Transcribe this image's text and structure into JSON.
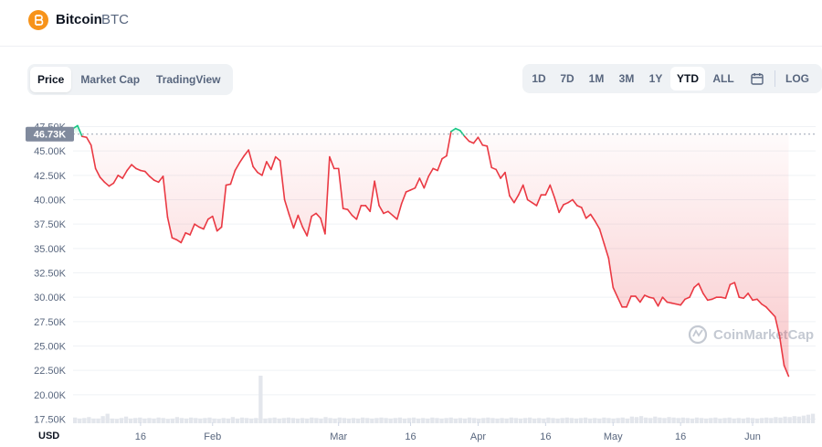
{
  "header": {
    "coin_name": "Bitcoin",
    "coin_symbol": "BTC",
    "logo_color": "#f7931a"
  },
  "tabs": [
    {
      "label": "Price",
      "active": true
    },
    {
      "label": "Market Cap",
      "active": false
    },
    {
      "label": "TradingView",
      "active": false
    }
  ],
  "ranges": [
    {
      "label": "1D",
      "active": false
    },
    {
      "label": "7D",
      "active": false
    },
    {
      "label": "1M",
      "active": false
    },
    {
      "label": "3M",
      "active": false
    },
    {
      "label": "1Y",
      "active": false
    },
    {
      "label": "YTD",
      "active": true
    },
    {
      "label": "ALL",
      "active": false
    }
  ],
  "calendar_icon": "calendar-icon",
  "log_label": "LOG",
  "watermark": "CoinMarketCap",
  "chart_data": {
    "type": "line",
    "currency_label": "USD",
    "reference_value": 46.73,
    "reference_label": "46.73K",
    "ylim": [
      17.5,
      48.25
    ],
    "y_unit": "K",
    "y_ticks": [
      {
        "v": 17.5,
        "label": "17.50K"
      },
      {
        "v": 20.0,
        "label": "20.00K"
      },
      {
        "v": 22.5,
        "label": "22.50K"
      },
      {
        "v": 25.0,
        "label": "25.00K"
      },
      {
        "v": 27.5,
        "label": "27.50K"
      },
      {
        "v": 30.0,
        "label": "30.00K"
      },
      {
        "v": 32.5,
        "label": "32.50K"
      },
      {
        "v": 35.0,
        "label": "35.00K"
      },
      {
        "v": 37.5,
        "label": "37.50K"
      },
      {
        "v": 40.0,
        "label": "40.00K"
      },
      {
        "v": 42.5,
        "label": "42.50K"
      },
      {
        "v": 45.0,
        "label": "45.00K"
      },
      {
        "v": 47.5,
        "label": "47.50K"
      }
    ],
    "x_ticks": [
      {
        "day": 15,
        "label": "16"
      },
      {
        "day": 31,
        "label": "Feb"
      },
      {
        "day": 59,
        "label": "Mar"
      },
      {
        "day": 75,
        "label": "16"
      },
      {
        "day": 90,
        "label": "Apr"
      },
      {
        "day": 105,
        "label": "16"
      },
      {
        "day": 120,
        "label": "May"
      },
      {
        "day": 135,
        "label": "16"
      },
      {
        "day": 151,
        "label": "Jun"
      }
    ],
    "xlim": [
      0,
      165
    ],
    "up_color": "#16c784",
    "down_color": "#ea3943",
    "series": [
      {
        "points": [
          [
            0,
            47.3
          ],
          [
            1,
            47.6
          ],
          [
            2,
            46.5
          ],
          [
            3,
            46.4
          ],
          [
            4,
            45.6
          ],
          [
            5,
            43.2
          ],
          [
            6,
            42.3
          ],
          [
            7,
            41.8
          ],
          [
            8,
            41.4
          ],
          [
            9,
            41.7
          ],
          [
            10,
            42.5
          ],
          [
            11,
            42.2
          ],
          [
            12,
            43.0
          ],
          [
            13,
            43.6
          ],
          [
            14,
            43.2
          ],
          [
            15,
            43.0
          ],
          [
            16,
            42.9
          ],
          [
            17,
            42.4
          ],
          [
            18,
            42.0
          ],
          [
            19,
            41.8
          ],
          [
            20,
            42.4
          ],
          [
            21,
            38.2
          ],
          [
            22,
            36.1
          ],
          [
            23,
            35.9
          ],
          [
            24,
            35.6
          ],
          [
            25,
            36.6
          ],
          [
            26,
            36.4
          ],
          [
            27,
            37.5
          ],
          [
            28,
            37.2
          ],
          [
            29,
            37.0
          ],
          [
            30,
            38.0
          ],
          [
            31,
            38.3
          ],
          [
            32,
            36.8
          ],
          [
            33,
            37.2
          ],
          [
            34,
            41.5
          ],
          [
            35,
            41.6
          ],
          [
            36,
            43.0
          ],
          [
            37,
            43.8
          ],
          [
            38,
            44.5
          ],
          [
            39,
            45.1
          ],
          [
            40,
            43.4
          ],
          [
            41,
            42.8
          ],
          [
            42,
            42.5
          ],
          [
            43,
            43.9
          ],
          [
            44,
            43.1
          ],
          [
            45,
            44.4
          ],
          [
            46,
            44.0
          ],
          [
            47,
            40.0
          ],
          [
            48,
            38.5
          ],
          [
            49,
            37.1
          ],
          [
            50,
            38.4
          ],
          [
            51,
            37.2
          ],
          [
            52,
            36.3
          ],
          [
            53,
            38.3
          ],
          [
            54,
            38.6
          ],
          [
            55,
            38.1
          ],
          [
            56,
            36.5
          ],
          [
            57,
            44.4
          ],
          [
            58,
            43.2
          ],
          [
            59,
            43.2
          ],
          [
            60,
            39.1
          ],
          [
            61,
            39.0
          ],
          [
            62,
            38.4
          ],
          [
            63,
            38.0
          ],
          [
            64,
            39.4
          ],
          [
            65,
            39.4
          ],
          [
            66,
            38.8
          ],
          [
            67,
            41.9
          ],
          [
            68,
            39.4
          ],
          [
            69,
            38.6
          ],
          [
            70,
            38.8
          ],
          [
            71,
            38.4
          ],
          [
            72,
            38.0
          ],
          [
            73,
            39.6
          ],
          [
            74,
            40.8
          ],
          [
            75,
            41.0
          ],
          [
            76,
            41.2
          ],
          [
            77,
            42.2
          ],
          [
            78,
            41.2
          ],
          [
            79,
            42.4
          ],
          [
            80,
            43.2
          ],
          [
            81,
            43.0
          ],
          [
            82,
            44.2
          ],
          [
            83,
            44.5
          ],
          [
            84,
            47.0
          ],
          [
            85,
            47.3
          ],
          [
            86,
            47.1
          ],
          [
            87,
            46.5
          ],
          [
            88,
            46.0
          ],
          [
            89,
            45.8
          ],
          [
            90,
            46.4
          ],
          [
            91,
            45.6
          ],
          [
            92,
            45.5
          ],
          [
            93,
            43.3
          ],
          [
            94,
            43.1
          ],
          [
            95,
            42.2
          ],
          [
            96,
            42.8
          ],
          [
            97,
            40.4
          ],
          [
            98,
            39.7
          ],
          [
            99,
            40.5
          ],
          [
            100,
            41.5
          ],
          [
            101,
            40.0
          ],
          [
            102,
            39.7
          ],
          [
            103,
            39.4
          ],
          [
            104,
            40.5
          ],
          [
            105,
            40.5
          ],
          [
            106,
            41.5
          ],
          [
            107,
            40.2
          ],
          [
            108,
            38.7
          ],
          [
            109,
            39.5
          ],
          [
            110,
            39.7
          ],
          [
            111,
            40.0
          ],
          [
            112,
            39.4
          ],
          [
            113,
            39.2
          ],
          [
            114,
            38.1
          ],
          [
            115,
            38.5
          ],
          [
            116,
            37.8
          ],
          [
            117,
            37.0
          ],
          [
            118,
            35.5
          ],
          [
            119,
            34.0
          ],
          [
            120,
            31.0
          ],
          [
            121,
            30.0
          ],
          [
            122,
            29.0
          ],
          [
            123,
            29.0
          ],
          [
            124,
            30.1
          ],
          [
            125,
            30.1
          ],
          [
            126,
            29.5
          ],
          [
            127,
            30.2
          ],
          [
            128,
            30.0
          ],
          [
            129,
            29.9
          ],
          [
            130,
            29.1
          ],
          [
            131,
            30.0
          ],
          [
            132,
            29.5
          ],
          [
            133,
            29.4
          ],
          [
            134,
            29.3
          ],
          [
            135,
            29.2
          ],
          [
            136,
            29.8
          ],
          [
            137,
            30.0
          ],
          [
            138,
            31.0
          ],
          [
            139,
            31.4
          ],
          [
            140,
            30.4
          ],
          [
            141,
            29.7
          ],
          [
            142,
            29.8
          ],
          [
            143,
            30.0
          ],
          [
            144,
            30.0
          ],
          [
            145,
            29.9
          ],
          [
            146,
            31.3
          ],
          [
            147,
            31.5
          ],
          [
            148,
            30.0
          ],
          [
            149,
            29.9
          ],
          [
            150,
            30.4
          ],
          [
            151,
            29.7
          ],
          [
            152,
            29.8
          ],
          [
            153,
            29.3
          ],
          [
            154,
            29.0
          ],
          [
            155,
            28.5
          ],
          [
            156,
            28.0
          ],
          [
            157,
            26.0
          ],
          [
            158,
            23.0
          ],
          [
            159,
            21.9
          ]
        ]
      }
    ],
    "volume": [
      12,
      10,
      11,
      13,
      10,
      10,
      15,
      20,
      10,
      9,
      11,
      14,
      10,
      11,
      12,
      10,
      11,
      10,
      12,
      11,
      9,
      10,
      13,
      11,
      10,
      12,
      11,
      10,
      11,
      12,
      10,
      9,
      11,
      10,
      13,
      10,
      12,
      11,
      10,
      11,
      100,
      10,
      11,
      12,
      10,
      11,
      12,
      11,
      10,
      11,
      10,
      12,
      11,
      10,
      13,
      11,
      10,
      12,
      11,
      10,
      11,
      10,
      12,
      11,
      10,
      11,
      12,
      11,
      10,
      11,
      12,
      10,
      11,
      12,
      10,
      11,
      10,
      12,
      11,
      10,
      11,
      12,
      10,
      11,
      10,
      12,
      11,
      10,
      11,
      12,
      11,
      10,
      11,
      10,
      12,
      11,
      10,
      11,
      12,
      10,
      11,
      10,
      12,
      11,
      10,
      11,
      12,
      11,
      10,
      11,
      12,
      10,
      11,
      10,
      12,
      11,
      10,
      11,
      12,
      10,
      14,
      13,
      15,
      12,
      11,
      14,
      12,
      11,
      13,
      12,
      11,
      12,
      11,
      10,
      12,
      11,
      10,
      11,
      12,
      10,
      11,
      12,
      10,
      11,
      10,
      12,
      11,
      10,
      11,
      12,
      11,
      13,
      12,
      14,
      13,
      15,
      14,
      16,
      18,
      20
    ]
  }
}
